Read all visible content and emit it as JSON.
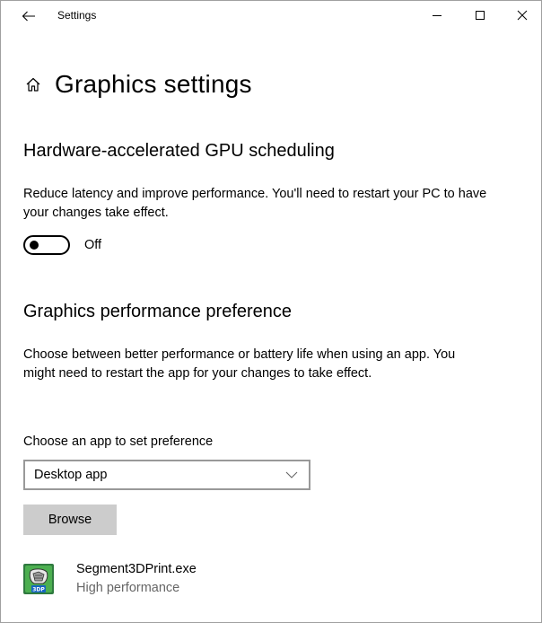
{
  "window": {
    "title": "Settings",
    "controls": {
      "minimize": "minimize-icon",
      "maximize": "maximize-icon",
      "close": "close-icon"
    }
  },
  "header": {
    "icon": "home-icon",
    "title": "Graphics settings"
  },
  "gpu_scheduling": {
    "heading": "Hardware-accelerated GPU scheduling",
    "description": "Reduce latency and improve performance. You'll need to restart your PC to have your changes take effect.",
    "toggle_state": "Off"
  },
  "performance_preference": {
    "heading": "Graphics performance preference",
    "description": "Choose between better performance or battery life when using an app. You might need to restart the app for your changes to take effect.",
    "dropdown_label": "Choose an app to set preference",
    "dropdown_value": "Desktop app",
    "browse_label": "Browse"
  },
  "apps": [
    {
      "name": "Segment3DPrint.exe",
      "preference": "High performance",
      "icon_badge": "3DP"
    }
  ],
  "colors": {
    "button_bg": "#cccccc",
    "secondary_text": "#666666",
    "dropdown_border": "#999999",
    "app_icon_bg": "#3a8d4c"
  }
}
